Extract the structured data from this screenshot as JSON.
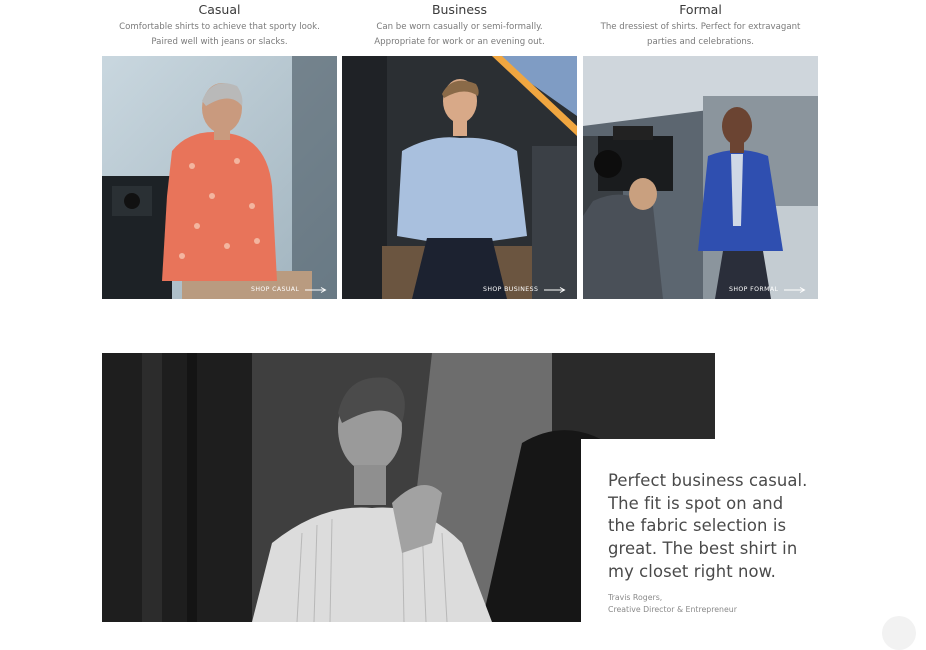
{
  "categories": [
    {
      "title": "Casual",
      "desc_line1": "Comfortable shirts to achieve that sporty look.",
      "desc_line2": "Paired well with jeans or slacks.",
      "shop_label": "SHOP CASUAL"
    },
    {
      "title": "Business",
      "desc_line1": "Can be worn casually or semi-formally.",
      "desc_line2": "Appropriate for work or an evening out.",
      "shop_label": "SHOP BUSINESS"
    },
    {
      "title": "Formal",
      "desc_line1": "The dressiest of shirts. Perfect for extravagant",
      "desc_line2": "parties and celebrations.",
      "shop_label": "SHOP FORMAL"
    }
  ],
  "testimonial": {
    "quote": "Perfect business casual. The fit is spot on and the fabric selection is great. The best shirt in my closet right now.",
    "name": "Travis Rogers,",
    "role": "Creative Director & Entrepreneur"
  },
  "colors": {
    "casual_shirt": "#e8745a",
    "business_shirt": "#a9c0de",
    "formal_blazer": "#2f4fb0",
    "accent_orange": "#f0a640"
  },
  "icons": {
    "shop_arrow": "long-arrow-right-icon"
  }
}
